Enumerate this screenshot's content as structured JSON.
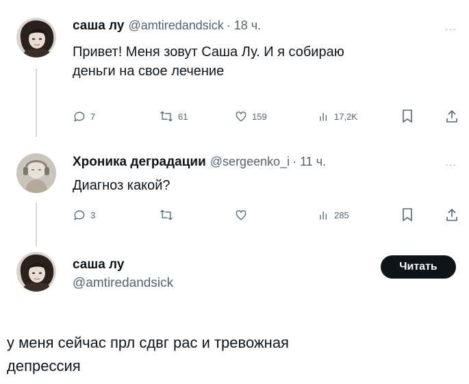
{
  "tweet1": {
    "name": "саша лу",
    "handle": "@amtiredandsick",
    "time": "· 18 ч.",
    "more": "···",
    "text_line1": "Привет! Меня зовут Саша Лу. И я собираю",
    "text_line2": "деньги на свое лечение",
    "replies": "7",
    "retweets": "61",
    "likes": "159",
    "views": "17,2K"
  },
  "tweet2": {
    "name": "Хроника деградации",
    "handle": "@sergeenko_i",
    "time": "· 11 ч.",
    "more": "···",
    "text": "Диагноз какой?",
    "replies": "3",
    "retweets": "",
    "likes": "",
    "views": "285"
  },
  "tweet3": {
    "name": "саша лу",
    "handle": "@amtiredandsick",
    "follow_label": "Читать",
    "text_line1": "у меня сейчас прл сдвг рас и тревожная",
    "text_line2": "депрессия"
  },
  "icons": [
    "reply-icon",
    "retweet-icon",
    "like-icon",
    "views-icon",
    "bookmark-icon",
    "share-icon"
  ],
  "colors": {
    "text": "#0f1419",
    "muted": "#536471",
    "line": "#cfd9de",
    "button": "#0f1419"
  }
}
